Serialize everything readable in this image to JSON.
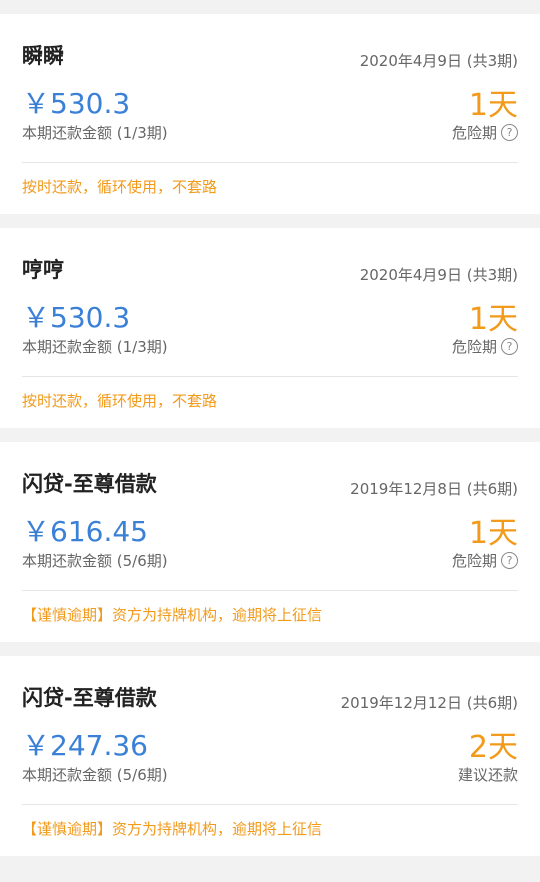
{
  "loans": [
    {
      "name": "瞬瞬",
      "date": "2020年4月9日 (共3期)",
      "amount": "￥530.3",
      "days": "1天",
      "period": "本期还款金额 (1/3期)",
      "status": "危险期",
      "status_icon": "question-circle-icon",
      "note": "按时还款，循环使用，不套路"
    },
    {
      "name": "哼哼",
      "date": "2020年4月9日 (共3期)",
      "amount": "￥530.3",
      "days": "1天",
      "period": "本期还款金额 (1/3期)",
      "status": "危险期",
      "status_icon": "question-circle-icon",
      "note": "按时还款，循环使用，不套路"
    },
    {
      "name": "闪贷-至尊借款",
      "date": "2019年12月8日 (共6期)",
      "amount": "￥616.45",
      "days": "1天",
      "period": "本期还款金额 (5/6期)",
      "status": "危险期",
      "status_icon": "question-circle-icon",
      "note": "【谨慎逾期】资方为持牌机构，逾期将上征信"
    },
    {
      "name": "闪贷-至尊借款",
      "date": "2019年12月12日 (共6期)",
      "amount": "￥247.36",
      "days": "2天",
      "period": "本期还款金额 (5/6期)",
      "status": "建议还款",
      "note": "【谨慎逾期】资方为持牌机构，逾期将上征信"
    }
  ],
  "colors": {
    "amount": "#3a80d6",
    "accent_orange": "#f29a1a",
    "background": "#f2f2f2"
  }
}
